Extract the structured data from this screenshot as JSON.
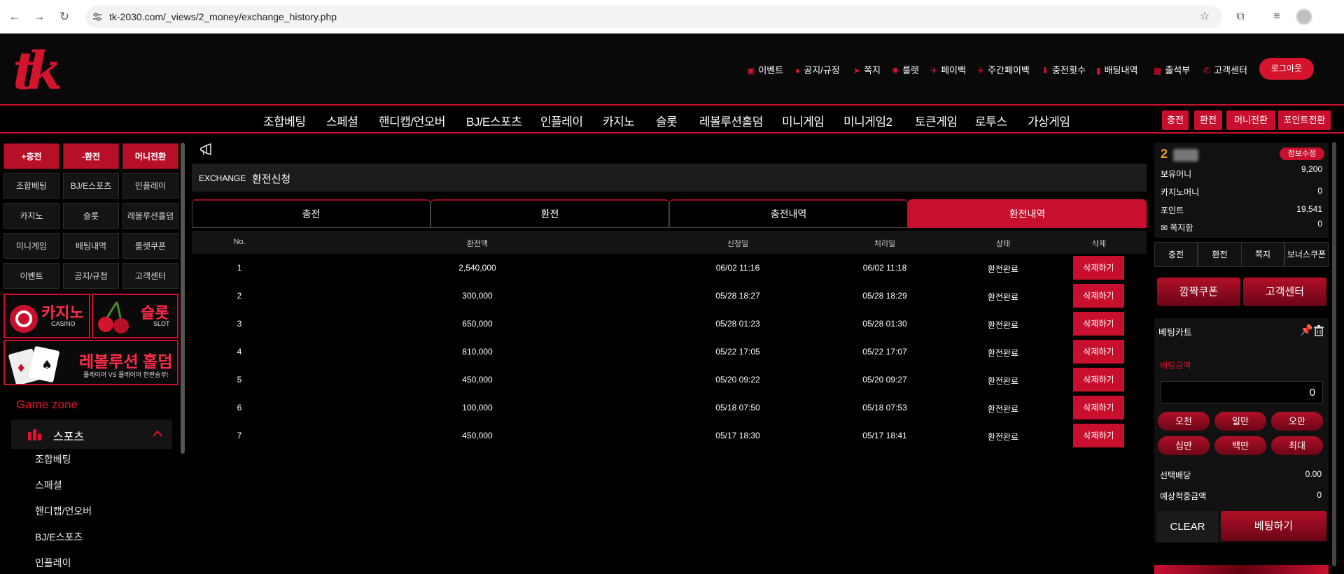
{
  "browser": {
    "url": "tk-2030.com/_views/2_money/exchange_history.php",
    "back_icon": "←",
    "forward_icon": "→",
    "reload_icon": "↻",
    "star_icon": "☆",
    "ext_icon": "⧉",
    "media_icon": "≡"
  },
  "header": {
    "logo": "tk",
    "links": [
      {
        "icon": "▣",
        "label": "이벤트"
      },
      {
        "icon": "●",
        "label": "공지/규정"
      },
      {
        "icon": "➤",
        "label": "쪽지"
      },
      {
        "icon": "✺",
        "label": "룰렛"
      },
      {
        "icon": "✈",
        "label": "페이백"
      },
      {
        "icon": "✈",
        "label": "주간페이백"
      },
      {
        "icon": "⬇",
        "label": "충전횟수"
      },
      {
        "icon": "▮",
        "label": "배팅내역"
      },
      {
        "icon": "▦",
        "label": "출석부"
      },
      {
        "icon": "✆",
        "label": "고객센터"
      }
    ],
    "logout": "로그아웃"
  },
  "menu": {
    "items": [
      "조합베팅",
      "스페셜",
      "핸디캡/언오버",
      "BJ/E스포츠",
      "인플레이",
      "카지노",
      "슬롯",
      "레볼루션홀덤",
      "미니게임",
      "미니게임2",
      "토큰게임",
      "로투스",
      "가상게임"
    ],
    "quick": [
      "충전",
      "환전",
      "머니전환",
      "포인트전환"
    ]
  },
  "left": {
    "top_buttons": [
      "+충전",
      "-환전",
      "머니전환"
    ],
    "grid": [
      "조합베팅",
      "BJ/E스포츠",
      "인플레이",
      "카지노",
      "슬롯",
      "레볼루션홀덤",
      "미니게임",
      "배팅내역",
      "룰렛쿠폰",
      "이벤트",
      "공지/규정",
      "고객센터"
    ],
    "promo_casino": {
      "title": "카지노",
      "sub": "CASINO"
    },
    "promo_slot": {
      "title": "슬롯",
      "sub": "SLOT"
    },
    "promo_holdem": {
      "title": "레볼루션 홀덤",
      "sub": "플레이어 VS 플레이어 한판승부!"
    },
    "game_zone": "Game zone",
    "sports": "스포츠",
    "sub_items": [
      "조합베팅",
      "스페셜",
      "핸디캡/언오버",
      "BJ/E스포츠",
      "인플레이"
    ]
  },
  "main": {
    "title_en": "EXCHANGE",
    "title_ko": "환전신청",
    "tabs": [
      "충전",
      "환전",
      "충전내역",
      "환전내역"
    ],
    "active_tab": 3,
    "columns": [
      "No.",
      "환전액",
      "신청일",
      "처리일",
      "상태",
      "삭제"
    ],
    "rows": [
      {
        "no": "1",
        "amount": "2,540,000",
        "req": "06/02 11:16",
        "done": "06/02 11:18",
        "status": "환전완료",
        "del": "삭제하기"
      },
      {
        "no": "2",
        "amount": "300,000",
        "req": "05/28 18:27",
        "done": "05/28 18:29",
        "status": "환전완료",
        "del": "삭제하기"
      },
      {
        "no": "3",
        "amount": "650,000",
        "req": "05/28 01:23",
        "done": "05/28 01:30",
        "status": "환전완료",
        "del": "삭제하기"
      },
      {
        "no": "4",
        "amount": "810,000",
        "req": "05/22 17:05",
        "done": "05/22 17:07",
        "status": "환전완료",
        "del": "삭제하기"
      },
      {
        "no": "5",
        "amount": "450,000",
        "req": "05/20 09:22",
        "done": "05/20 09:27",
        "status": "환전완료",
        "del": "삭제하기"
      },
      {
        "no": "6",
        "amount": "100,000",
        "req": "05/18 07:50",
        "done": "05/18 07:53",
        "status": "환전완료",
        "del": "삭제하기"
      },
      {
        "no": "7",
        "amount": "450,000",
        "req": "05/17 18:30",
        "done": "05/17 18:41",
        "status": "환전완료",
        "del": "삭제하기"
      }
    ]
  },
  "right": {
    "user_level": "2",
    "edit": "정보수정",
    "money_label": "보유머니",
    "money": "9,200",
    "casino_label": "카지노머니",
    "casino": "0",
    "point_label": "포인트",
    "point": "19,541",
    "memo_label": "쪽지함",
    "memo": "0",
    "btns": [
      "충전",
      "환전",
      "쪽지",
      "보너스쿠폰"
    ],
    "coupon": "깜짝쿠폰",
    "support": "고객센터",
    "cart_title": "베팅카트",
    "amount_label": "베팅금액",
    "amount_value": "0",
    "chips": [
      "오천",
      "일만",
      "오만",
      "십만",
      "백만",
      "최대"
    ],
    "odds_label": "선택배당",
    "odds": "0.00",
    "win_label": "예상적중금액",
    "win": "0",
    "clear": "CLEAR",
    "bet": "베팅하기"
  },
  "colors": {
    "accent": "#c8102e",
    "bg": "#000000",
    "level": "#f0a020"
  }
}
